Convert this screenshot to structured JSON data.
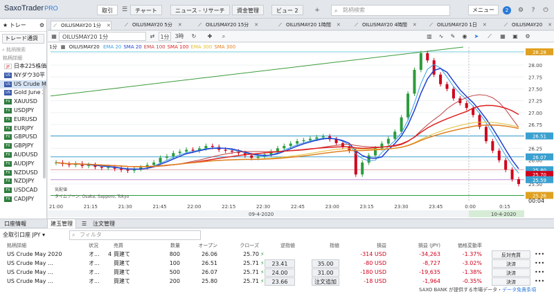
{
  "app": {
    "name": "SaxoTrader",
    "suffix": "PRO"
  },
  "nav": {
    "tabs": [
      "取引",
      "チャート",
      "ニュース - リサーチ",
      "資金管理",
      "ビュー 2"
    ],
    "add": "+",
    "search_placeholder": "銘柄検索",
    "menu": "メニュー",
    "notifications": "2"
  },
  "watchlist": {
    "title": "トレー",
    "selector": "トレード通貨",
    "search": "銘柄検索",
    "label": "銘柄詳細",
    "items": [
      {
        "name": "日本225株価",
        "flag": "JP"
      },
      {
        "name": "NYダウ30平",
        "flag": "US"
      },
      {
        "name": "US Crude M",
        "flag": "US"
      },
      {
        "name": "Gold June 2",
        "flag": "US"
      },
      {
        "name": "XAUUSD",
        "flag": "FX"
      },
      {
        "name": "USDJPY",
        "flag": "FX"
      },
      {
        "name": "EURUSD",
        "flag": "FX"
      },
      {
        "name": "EURJPY",
        "flag": "FX"
      },
      {
        "name": "GBPUSD",
        "flag": "FX"
      },
      {
        "name": "GBPJPY",
        "flag": "FX"
      },
      {
        "name": "AUDUSD",
        "flag": "FX"
      },
      {
        "name": "AUDJPY",
        "flag": "FX"
      },
      {
        "name": "NZDUSD",
        "flag": "FX"
      },
      {
        "name": "NZDJPY",
        "flag": "FX"
      },
      {
        "name": "USDCAD",
        "flag": "FX"
      },
      {
        "name": "CADJPY",
        "flag": "FX"
      }
    ]
  },
  "chart_tabs": [
    "OILUSMAY20 1分",
    "OILUSMAY20 5分",
    "OILUSMAY20 15分",
    "OILUSMAY20 1時間",
    "OILUSMAY20 4時間",
    "OILUSMAY20 1日",
    "OILUSMAY20"
  ],
  "chart_toolbar": {
    "instrument": "OILUSMAY20 1分",
    "interval": "1分",
    "range": "3時間"
  },
  "chart_legend": {
    "interval": "1分",
    "symbol": "OILUSMAY20",
    "indicators": [
      {
        "label": "EMA 20",
        "color": "#3aa0e0"
      },
      {
        "label": "SMA 20",
        "color": "#1f3fd0"
      },
      {
        "label": "EMA 100",
        "color": "#c04040"
      },
      {
        "label": "SMA 100",
        "color": "#e02020"
      },
      {
        "label": "EMA 300",
        "color": "#e0c030"
      },
      {
        "label": "SMA 300",
        "color": "#e08020"
      }
    ]
  },
  "chart_data": {
    "type": "line",
    "x_ticks": [
      "21:00",
      "21:15",
      "21:30",
      "21:45",
      "22:00",
      "22:15",
      "22:30",
      "22:45",
      "23:00",
      "23:15",
      "23:30",
      "23:45",
      "0:00",
      "0:15"
    ],
    "dates": [
      "09-4-2020",
      "10-4-2020"
    ],
    "y_ticks": [
      25.5,
      25.75,
      26.0,
      26.25,
      26.5,
      26.75,
      27.0,
      27.25,
      27.5,
      27.75,
      28.0,
      28.25
    ],
    "ylim": [
      25.15,
      28.38
    ],
    "price_labels": [
      {
        "value": 28.28,
        "text": "28.28"
      },
      {
        "value": 26.51,
        "text": "26.51"
      },
      {
        "value": 26.07,
        "text": "26.07"
      },
      {
        "value": 25.8,
        "text": "25.80"
      },
      {
        "value": 25.7,
        "text": "25.70"
      },
      {
        "value": 25.59,
        "text": "25.59"
      },
      {
        "value": 25.26,
        "text": "25.26"
      }
    ],
    "last_time": "00:04",
    "timezone_label": "気配値",
    "timezone_text": "タイムゾーン: Osaka, Sapporo, Tokyo",
    "close_series": [
      25.95,
      25.92,
      25.9,
      25.93,
      25.88,
      25.9,
      25.86,
      25.84,
      25.85,
      25.82,
      25.8,
      25.78,
      25.82,
      25.85,
      25.9,
      25.95,
      26.05,
      26.08,
      26.15,
      26.18,
      26.22,
      26.2,
      26.25,
      26.3,
      26.28,
      26.22,
      26.2,
      26.18,
      26.15,
      26.1,
      26.05,
      26.08,
      26.12,
      26.18,
      26.25,
      26.3,
      26.35,
      26.4,
      26.42,
      26.45,
      26.48,
      26.5,
      26.44,
      26.36,
      26.28,
      26.2,
      25.7,
      25.95,
      26.1,
      26.25,
      26.35,
      26.45,
      26.6,
      26.9,
      27.4,
      27.9,
      28.25,
      28.1,
      27.8,
      27.6,
      27.5,
      27.3,
      27.2,
      27.1,
      26.95,
      26.7,
      26.4,
      26.2,
      26.0,
      25.8,
      25.6,
      25.5
    ]
  },
  "bottom_tabs": [
    "口座情報",
    "建玉管理",
    "注文管理"
  ],
  "positions": {
    "account": "全取引口座",
    "currency": "JPY",
    "filter_placeholder": "フィルタ",
    "columns": [
      "銘柄詳細",
      "状況",
      "売買",
      "数量",
      "オープン",
      "クローズ",
      "逆指値",
      "指値",
      "損益",
      "損益 (JPY)",
      "価格変動率"
    ],
    "rows": [
      {
        "name": "US Crude May 2020",
        "status": "オ...",
        "count": "4",
        "side": "買建て",
        "qty": "800",
        "open": "26.06",
        "close": "25.70",
        "stop": "",
        "limit": "",
        "pnl": "-314 USD",
        "pnl_jpy": "-34,263",
        "change": "-1.37%",
        "action": "反対売買"
      },
      {
        "name": "US Crude May ...",
        "status": "オ...",
        "count": "",
        "side": "買建て",
        "qty": "100",
        "open": "26.51",
        "close": "25.71",
        "stop": "23.41",
        "limit": "35.00",
        "pnl": "-80 USD",
        "pnl_jpy": "-8,727",
        "change": "-3.02%",
        "action": "決済"
      },
      {
        "name": "US Crude May ...",
        "status": "オ...",
        "count": "",
        "side": "買建て",
        "qty": "500",
        "open": "26.07",
        "close": "25.71",
        "stop": "24.00",
        "limit": "31.00",
        "pnl": "-180 USD",
        "pnl_jpy": "-19,635",
        "change": "-1.38%",
        "action": "決済"
      },
      {
        "name": "US Crude May ...",
        "status": "オ...",
        "count": "",
        "side": "買建て",
        "qty": "200",
        "open": "25.80",
        "close": "25.71",
        "stop": "23.66",
        "limit": "注文追加",
        "pnl": "-18 USD",
        "pnl_jpy": "-1,964",
        "change": "-0.35%",
        "action": "決済"
      }
    ]
  },
  "footer": {
    "text": "SAXO BANK が提供する市場データ・",
    "link": "データ免責条項"
  }
}
